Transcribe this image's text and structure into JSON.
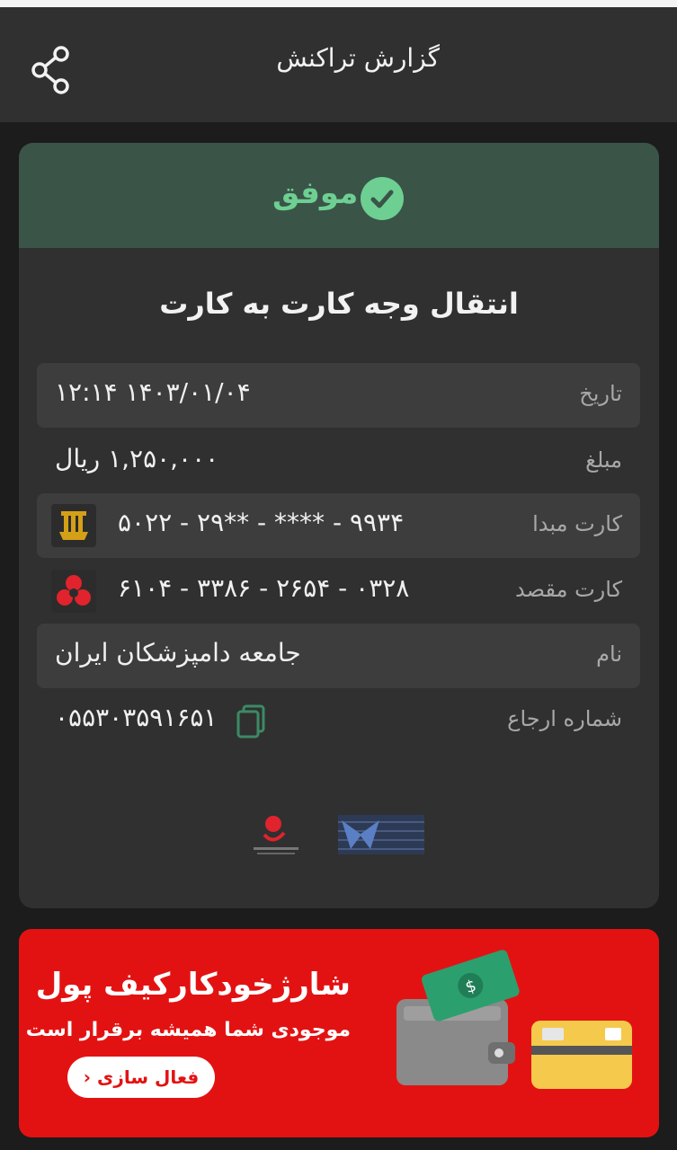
{
  "header": {
    "title": "گزارش تراکنش"
  },
  "status": {
    "label": "موفق"
  },
  "transaction": {
    "type": "انتقال وجه کارت به کارت",
    "rows": [
      {
        "label": "تاریخ",
        "value": "۱۴۰۳/۰۱/۰۴ ۱۲:۱۴"
      },
      {
        "label": "مبلغ",
        "value": "۱,۲۵۰,۰۰۰ ریال"
      },
      {
        "label": "کارت مبدا",
        "value": "۵۰۲۲ - ۲۹** - **** - ۹۹۳۴"
      },
      {
        "label": "کارت مقصد",
        "value": "۶۱۰۴ - ۳۳۸۶ - ۲۶۵۴ - ۰۳۲۸"
      },
      {
        "label": "نام",
        "value": "جامعه دامپزشکان ایران"
      },
      {
        "label": "شماره ارجاع",
        "value": "۰۵۵۳۰۳۵۹۱۶۵۱"
      }
    ]
  },
  "banner": {
    "title": "شارژخودکارکیف پول",
    "subtitle": "موجودی شما همیشه برقرار است",
    "button_label": "فعال سازی"
  },
  "icons": [
    "share-icon",
    "check-circle-icon",
    "pasargad-bank-logo",
    "mellat-bank-logo",
    "copy-icon",
    "ap-logo",
    "shaparak-logo",
    "wallet-icon",
    "credit-card-icon",
    "chevron-left-icon"
  ],
  "colors": {
    "success": "#6ecf92",
    "status_bg": "#3a5448",
    "banner_red": "#e31212",
    "card_bg": "#303030"
  }
}
